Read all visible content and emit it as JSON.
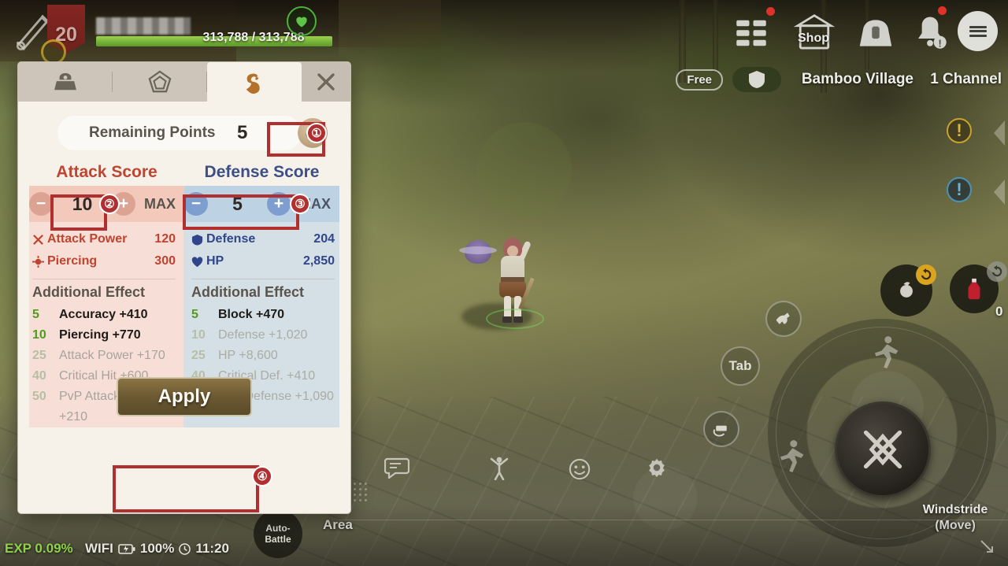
{
  "hud": {
    "level": "20",
    "hp_current_max": "313,788 / 313,788",
    "heart_icon": "heart-icon",
    "top_icons": [
      {
        "name": "grid-menu-icon",
        "label": ""
      },
      {
        "name": "shop-icon",
        "label": "Shop"
      },
      {
        "name": "bag-icon",
        "label": ""
      },
      {
        "name": "bell-icon",
        "label": ""
      },
      {
        "name": "hamburger-icon",
        "label": ""
      }
    ],
    "free_badge": "Free",
    "shield_icon": "shield-icon",
    "location": "Bamboo Village",
    "channel": "1 Channel",
    "quest_gold": "!",
    "quest_blue": "!",
    "exp": "EXP 0.09%",
    "network": "WIFI",
    "battery": "100%",
    "clock": "11:20",
    "auto_battle_line1": "Auto-",
    "auto_battle_line2": "Battle",
    "area_label": "Area",
    "tab_button": "Tab",
    "windstride_line1": "Windstride",
    "windstride_line2": "(Move)",
    "potion_count": "0"
  },
  "panel": {
    "tabs": [
      {
        "name": "tab-equipment",
        "icon": "armor-helmet-icon",
        "active": false
      },
      {
        "name": "tab-gem",
        "icon": "pentagon-gem-icon",
        "active": false
      },
      {
        "name": "tab-dragon",
        "icon": "dragon-icon",
        "active": true
      }
    ],
    "close_icon": "close-icon",
    "remaining_points_label": "Remaining Points",
    "remaining_points_value": "5",
    "reset_icon": "refresh-icon",
    "attack": {
      "title": "Attack Score",
      "color": "#c0442f",
      "minus": "−",
      "plus": "+",
      "value": "10",
      "max_label": "MAX",
      "stats": [
        {
          "icon": "crossed-swords-icon",
          "label": "Attack Power",
          "value": "120"
        },
        {
          "icon": "piercing-arrow-icon",
          "label": "Piercing",
          "value": "300"
        }
      ],
      "additional_title": "Additional Effect",
      "effects": [
        {
          "level": "5",
          "text": "Accuracy +410",
          "unlocked": true
        },
        {
          "level": "10",
          "text": "Piercing +770",
          "unlocked": true
        },
        {
          "level": "25",
          "text": "Attack Power +170",
          "unlocked": false
        },
        {
          "level": "40",
          "text": "Critical Hit +600",
          "unlocked": false
        },
        {
          "level": "50",
          "text": "PvP Attack Power +210",
          "unlocked": false
        }
      ]
    },
    "defense": {
      "title": "Defense Score",
      "color": "#3c4f86",
      "minus": "−",
      "plus": "+",
      "value": "5",
      "max_label": "MAX",
      "stats": [
        {
          "icon": "shield-icon",
          "label": "Defense",
          "value": "204"
        },
        {
          "icon": "heart-icon",
          "label": "HP",
          "value": "2,850"
        }
      ],
      "additional_title": "Additional Effect",
      "effects": [
        {
          "level": "5",
          "text": "Block +470",
          "unlocked": true
        },
        {
          "level": "10",
          "text": "Defense +1,020",
          "unlocked": false
        },
        {
          "level": "25",
          "text": "HP +8,600",
          "unlocked": false
        },
        {
          "level": "40",
          "text": "Critical Def. +410",
          "unlocked": false
        },
        {
          "level": "50",
          "text": "PvP Defense +1,090",
          "unlocked": false
        }
      ]
    },
    "apply_label": "Apply"
  },
  "annotations": [
    {
      "number": "①",
      "target": "reset-points-button"
    },
    {
      "number": "②",
      "target": "attack-score-value"
    },
    {
      "number": "③",
      "target": "defense-score-stepper"
    },
    {
      "number": "④",
      "target": "apply-button"
    }
  ],
  "colors": {
    "annotation_red": "#b22f2f",
    "attack_red": "#c0442f",
    "defense_blue": "#3c4f86",
    "unlocked_green": "#4f9b1e",
    "apply_gold": "#6d5a33"
  }
}
